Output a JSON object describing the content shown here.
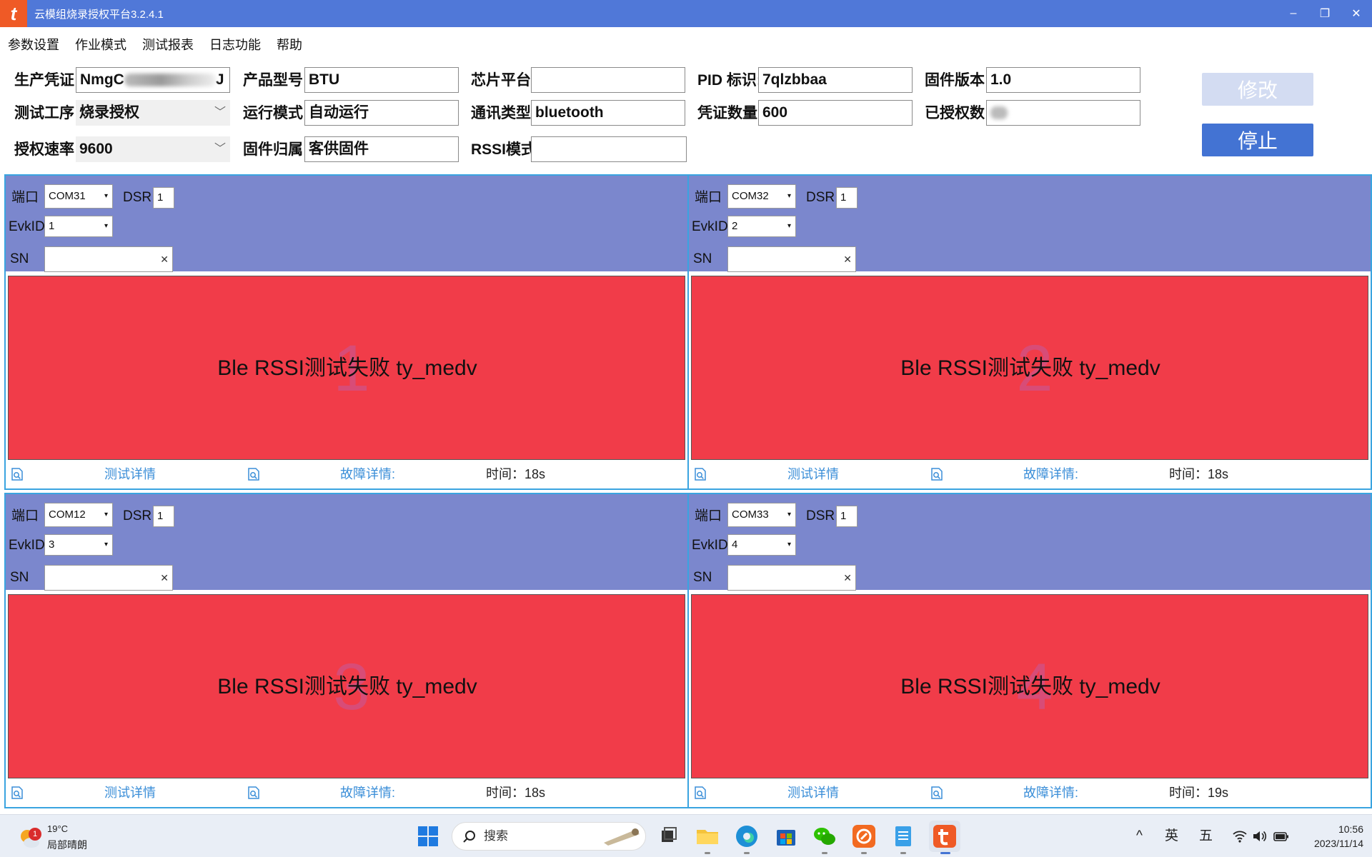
{
  "window": {
    "title": "云模组烧录授权平台3.2.4.1",
    "logo_glyph": "t",
    "minimize": "–",
    "restore": "❐",
    "close": "✕"
  },
  "menu": [
    "参数设置",
    "作业模式",
    "测试报表",
    "日志功能",
    "帮助"
  ],
  "form": {
    "cert_label": "生产凭证:",
    "cert_value_prefix": "NmgC",
    "cert_value_suffix": "J",
    "product_label": "产品型号:",
    "product_value": "BTU",
    "chip_label": "芯片平台:",
    "chip_value": "",
    "pid_label": "PID 标识:",
    "pid_value": "7qlzbbaa",
    "fw_version_label": "固件版本:",
    "fw_version_value": "1.0",
    "process_label": "测试工序:",
    "process_value": "烧录授权",
    "run_mode_label": "运行模式:",
    "run_mode_value": "自动运行",
    "comm_label": "通讯类型:",
    "comm_value": "bluetooth",
    "cert_count_label": "凭证数量:",
    "cert_count_value": "600",
    "authorized_label": "已授权数:",
    "authorized_value": "",
    "baud_label": "授权速率:",
    "baud_value": "9600",
    "fw_owner_label": "固件归属:",
    "fw_owner_value": "客供固件",
    "rssi_label": "RSSI模式",
    "rssi_value": ""
  },
  "buttons": {
    "modify": "修改",
    "stop": "停止"
  },
  "stations": [
    {
      "number": "1",
      "port_label": "端口",
      "port": "COM31",
      "dsr_label": "DSR",
      "dsr": "1",
      "evk_label": "EvkID",
      "evk": "1",
      "sn_label": "SN",
      "sn": "",
      "result": "Ble RSSI测试失败  ty_medv",
      "test_detail": "测试详情",
      "fault_detail": "故障详情:",
      "time": "时间：18s"
    },
    {
      "number": "2",
      "port_label": "端口",
      "port": "COM32",
      "dsr_label": "DSR",
      "dsr": "1",
      "evk_label": "EvkID",
      "evk": "2",
      "sn_label": "SN",
      "sn": "",
      "result": "Ble RSSI测试失败  ty_medv",
      "test_detail": "测试详情",
      "fault_detail": "故障详情:",
      "time": "时间：18s"
    },
    {
      "number": "3",
      "port_label": "端口",
      "port": "COM12",
      "dsr_label": "DSR",
      "dsr": "1",
      "evk_label": "EvkID",
      "evk": "3",
      "sn_label": "SN",
      "sn": "",
      "result": "Ble RSSI测试失败  ty_medv",
      "test_detail": "测试详情",
      "fault_detail": "故障详情:",
      "time": "时间：18s"
    },
    {
      "number": "4",
      "port_label": "端口",
      "port": "COM33",
      "dsr_label": "DSR",
      "dsr": "1",
      "evk_label": "EvkID",
      "evk": "4",
      "sn_label": "SN",
      "sn": "",
      "result": "Ble RSSI测试失败  ty_medv",
      "test_detail": "测试详情",
      "fault_detail": "故障详情:",
      "time": "时间：19s"
    }
  ],
  "taskbar": {
    "weather_badge": "1",
    "temperature": "19°C",
    "condition": "局部晴朗",
    "search": "搜索",
    "tray_chevron": "^",
    "ime_lang": "英",
    "ime_mode": "五",
    "time": "10:56",
    "date": "2023/11/14"
  },
  "colors": {
    "titlebar": "#5078d8",
    "panel_header": "#7b87cd",
    "fail_red": "#f13c49",
    "stop_button": "#4373d3",
    "link_blue": "#3a8ed8"
  }
}
